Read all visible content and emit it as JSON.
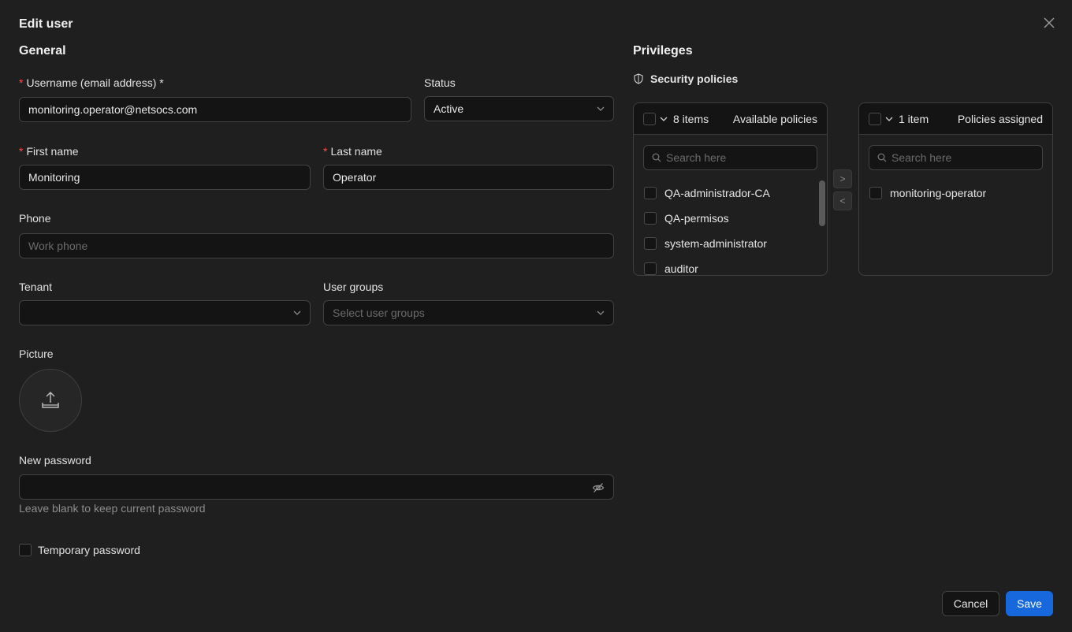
{
  "dialog": {
    "title": "Edit user"
  },
  "general": {
    "title": "General",
    "username": {
      "label": "Username (email address) *",
      "value": "monitoring.operator@netsocs.com"
    },
    "status": {
      "label": "Status",
      "value": "Active"
    },
    "first_name": {
      "label": "First name",
      "value": "Monitoring"
    },
    "last_name": {
      "label": "Last name",
      "value": "Operator"
    },
    "phone": {
      "label": "Phone",
      "placeholder": "Work phone"
    },
    "tenant": {
      "label": "Tenant",
      "value": ""
    },
    "user_groups": {
      "label": "User groups",
      "placeholder": "Select user groups"
    },
    "picture": {
      "label": "Picture"
    },
    "new_password": {
      "label": "New password",
      "hint": "Leave blank to keep current password"
    },
    "temporary_password": {
      "label": "Temporary password",
      "checked": false
    }
  },
  "privileges": {
    "title": "Privileges",
    "security_policies_label": "Security policies",
    "available": {
      "count": "8 items",
      "title": "Available policies",
      "search_placeholder": "Search here",
      "items": [
        "QA-administrador-CA",
        "QA-permisos",
        "system-administrator",
        "auditor"
      ]
    },
    "assigned": {
      "count": "1 item",
      "title": "Policies assigned",
      "search_placeholder": "Search here",
      "items": [
        "monitoring-operator"
      ]
    },
    "move_right_label": ">",
    "move_left_label": "<"
  },
  "footer": {
    "cancel_label": "Cancel",
    "save_label": "Save"
  },
  "colors": {
    "accent": "#1668dc",
    "required": "#ff4d4f",
    "background": "#1f1f1f"
  }
}
